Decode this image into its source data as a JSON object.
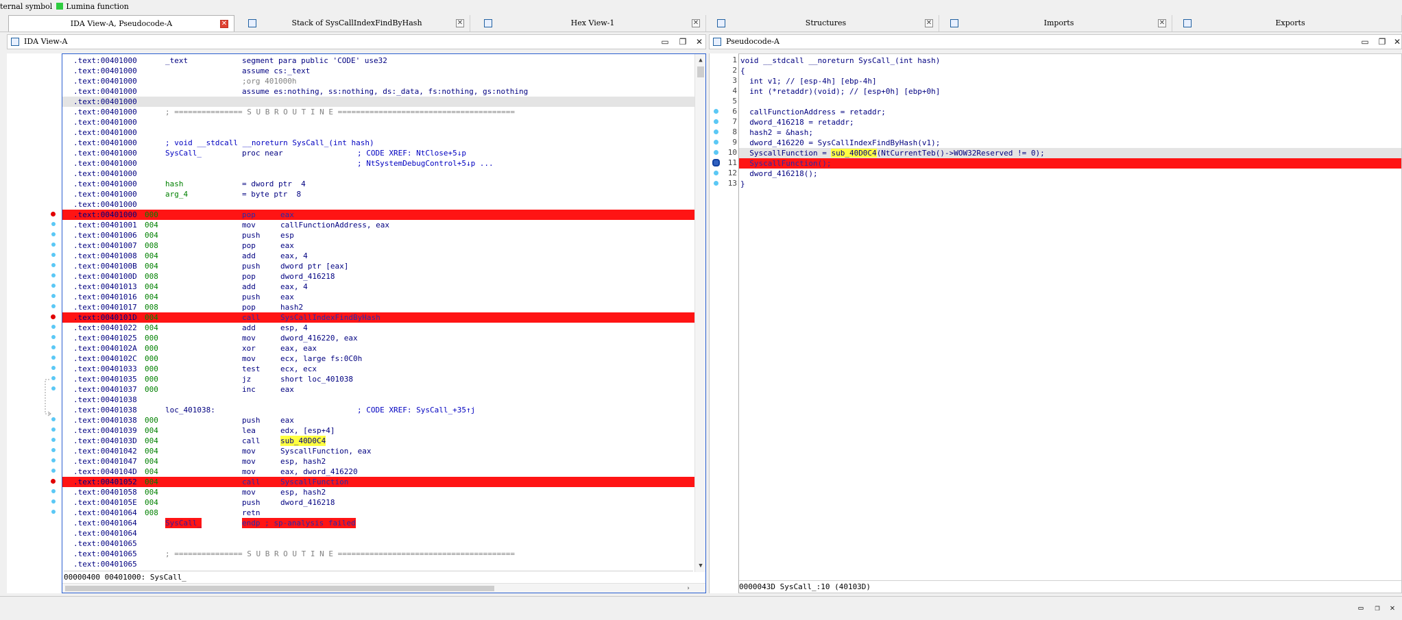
{
  "legend": {
    "prefix": "ternal symbol",
    "lumina": "Lumina function"
  },
  "tabs": [
    {
      "label": "IDA View-A, Pseudocode-A",
      "active": true
    },
    {
      "label": "Stack of SysCallIndexFindByHash"
    },
    {
      "label": "Hex View-1"
    },
    {
      "label": "Structures"
    },
    {
      "label": "Imports"
    },
    {
      "label": "Exports"
    }
  ],
  "ida_view": {
    "title": "IDA View-A",
    "status": "00000400 00401000: SysCall_",
    "lines": [
      {
        "a": ".text:00401000",
        "sp": "",
        "l": "_text",
        "i": "segment para public 'CODE' use32",
        "o": "",
        "c": "",
        "t": "seg"
      },
      {
        "a": ".text:00401000",
        "sp": "",
        "l": "",
        "i": "assume cs:_text",
        "o": "",
        "c": "",
        "t": "seg"
      },
      {
        "a": ".text:00401000",
        "sp": "",
        "l": "",
        "i": ";org 401000h",
        "o": "",
        "c": "",
        "t": "gray"
      },
      {
        "a": ".text:00401000",
        "sp": "",
        "l": "",
        "i": "assume es:nothing, ss:nothing, ds:_data, fs:nothing, gs:nothing",
        "o": "",
        "c": "",
        "t": "seg"
      },
      {
        "a": ".text:00401000",
        "sp": "",
        "l": "",
        "i": "",
        "o": "",
        "c": "",
        "t": "sel"
      },
      {
        "a": ".text:00401000",
        "sp": "",
        "l": "; =============== S U B R O U T I N E =======================================",
        "i": "",
        "o": "",
        "c": "",
        "t": "gray"
      },
      {
        "a": ".text:00401000",
        "sp": "",
        "l": "",
        "i": "",
        "o": "",
        "c": "",
        "t": ""
      },
      {
        "a": ".text:00401000",
        "sp": "",
        "l": "",
        "i": "",
        "o": "",
        "c": "",
        "t": ""
      },
      {
        "a": ".text:00401000",
        "sp": "",
        "l": "; void __stdcall __noreturn SysCall_(int hash)",
        "i": "",
        "o": "",
        "c": "",
        "t": "com"
      },
      {
        "a": ".text:00401000",
        "sp": "",
        "l": "SysCall_",
        "i": "proc near",
        "o": "",
        "c": "; CODE XREF: NtClose+5↓p",
        "t": "proc"
      },
      {
        "a": ".text:00401000",
        "sp": "",
        "l": "",
        "i": "",
        "o": "",
        "c": "; NtSystemDebugControl+5↓p ...",
        "t": ""
      },
      {
        "a": ".text:00401000",
        "sp": "",
        "l": "",
        "i": "",
        "o": "",
        "c": "",
        "t": ""
      },
      {
        "a": ".text:00401000",
        "sp": "",
        "l": "hash",
        "i": "= dword ptr  4",
        "o": "",
        "c": "",
        "t": "var"
      },
      {
        "a": ".text:00401000",
        "sp": "",
        "l": "arg_4",
        "i": "= byte ptr  8",
        "o": "",
        "c": "",
        "t": "var"
      },
      {
        "a": ".text:00401000",
        "sp": "",
        "l": "",
        "i": "",
        "o": "",
        "c": "",
        "t": ""
      },
      {
        "a": ".text:00401000",
        "sp": "000",
        "l": "",
        "i": "pop",
        "o": "eax",
        "c": "",
        "t": "bp"
      },
      {
        "a": ".text:00401001",
        "sp": "004",
        "l": "",
        "i": "mov",
        "o": "callFunctionAddress, eax",
        "c": "",
        "t": ""
      },
      {
        "a": ".text:00401006",
        "sp": "004",
        "l": "",
        "i": "push",
        "o": "esp",
        "c": "",
        "t": ""
      },
      {
        "a": ".text:00401007",
        "sp": "008",
        "l": "",
        "i": "pop",
        "o": "eax",
        "c": "",
        "t": ""
      },
      {
        "a": ".text:00401008",
        "sp": "004",
        "l": "",
        "i": "add",
        "o": "eax, 4",
        "c": "",
        "t": ""
      },
      {
        "a": ".text:0040100B",
        "sp": "004",
        "l": "",
        "i": "push",
        "o": "dword ptr [eax]",
        "c": "",
        "t": ""
      },
      {
        "a": ".text:0040100D",
        "sp": "008",
        "l": "",
        "i": "pop",
        "o": "dword_416218",
        "c": "",
        "t": ""
      },
      {
        "a": ".text:00401013",
        "sp": "004",
        "l": "",
        "i": "add",
        "o": "eax, 4",
        "c": "",
        "t": ""
      },
      {
        "a": ".text:00401016",
        "sp": "004",
        "l": "",
        "i": "push",
        "o": "eax",
        "c": "",
        "t": ""
      },
      {
        "a": ".text:00401017",
        "sp": "008",
        "l": "",
        "i": "pop",
        "o": "hash2",
        "c": "",
        "t": ""
      },
      {
        "a": ".text:0040101D",
        "sp": "004",
        "l": "",
        "i": "call",
        "o": "SysCallIndexFindByHash",
        "c": "",
        "t": "bp"
      },
      {
        "a": ".text:00401022",
        "sp": "004",
        "l": "",
        "i": "add",
        "o": "esp, 4",
        "c": "",
        "t": ""
      },
      {
        "a": ".text:00401025",
        "sp": "000",
        "l": "",
        "i": "mov",
        "o": "dword_416220, eax",
        "c": "",
        "t": ""
      },
      {
        "a": ".text:0040102A",
        "sp": "000",
        "l": "",
        "i": "xor",
        "o": "eax, eax",
        "c": "",
        "t": ""
      },
      {
        "a": ".text:0040102C",
        "sp": "000",
        "l": "",
        "i": "mov",
        "o": "ecx, large fs:0C0h",
        "c": "",
        "t": ""
      },
      {
        "a": ".text:00401033",
        "sp": "000",
        "l": "",
        "i": "test",
        "o": "ecx, ecx",
        "c": "",
        "t": ""
      },
      {
        "a": ".text:00401035",
        "sp": "000",
        "l": "",
        "i": "jz",
        "o": "short loc_401038",
        "c": "",
        "t": ""
      },
      {
        "a": ".text:00401037",
        "sp": "000",
        "l": "",
        "i": "inc",
        "o": "eax",
        "c": "",
        "t": ""
      },
      {
        "a": ".text:00401038",
        "sp": "",
        "l": "",
        "i": "",
        "o": "",
        "c": "",
        "t": ""
      },
      {
        "a": ".text:00401038",
        "sp": "",
        "l": "loc_401038:",
        "i": "",
        "o": "",
        "c": "; CODE XREF: SysCall_+35↑j",
        "t": "lbl"
      },
      {
        "a": ".text:00401038",
        "sp": "000",
        "l": "",
        "i": "push",
        "o": "eax",
        "c": "",
        "t": ""
      },
      {
        "a": ".text:00401039",
        "sp": "004",
        "l": "",
        "i": "lea",
        "o": "edx, [esp+4]",
        "c": "",
        "t": "lea"
      },
      {
        "a": ".text:0040103D",
        "sp": "004",
        "l": "",
        "i": "call",
        "o": "sub_40D0C4",
        "c": "",
        "t": "hly"
      },
      {
        "a": ".text:00401042",
        "sp": "004",
        "l": "",
        "i": "mov",
        "o": "SyscallFunction, eax",
        "c": "",
        "t": ""
      },
      {
        "a": ".text:00401047",
        "sp": "004",
        "l": "",
        "i": "mov",
        "o": "esp, hash2",
        "c": "",
        "t": ""
      },
      {
        "a": ".text:0040104D",
        "sp": "004",
        "l": "",
        "i": "mov",
        "o": "eax, dword_416220",
        "c": "",
        "t": ""
      },
      {
        "a": ".text:00401052",
        "sp": "004",
        "l": "",
        "i": "call",
        "o": "SyscallFunction",
        "c": "",
        "t": "bp"
      },
      {
        "a": ".text:00401058",
        "sp": "004",
        "l": "",
        "i": "mov",
        "o": "esp, hash2",
        "c": "",
        "t": ""
      },
      {
        "a": ".text:0040105E",
        "sp": "004",
        "l": "",
        "i": "push",
        "o": "dword_416218",
        "c": "",
        "t": ""
      },
      {
        "a": ".text:00401064",
        "sp": "008",
        "l": "",
        "i": "retn",
        "o": "",
        "c": "",
        "t": ""
      },
      {
        "a": ".text:00401064",
        "sp": "",
        "l": "SysCall_",
        "i": "endp ; sp-analysis failed",
        "o": "",
        "c": "",
        "t": "endp"
      },
      {
        "a": ".text:00401064",
        "sp": "",
        "l": "",
        "i": "",
        "o": "",
        "c": "",
        "t": ""
      },
      {
        "a": ".text:00401065",
        "sp": "",
        "l": "",
        "i": "",
        "o": "",
        "c": "",
        "t": ""
      },
      {
        "a": ".text:00401065",
        "sp": "",
        "l": "; =============== S U B R O U T I N E =======================================",
        "i": "",
        "o": "",
        "c": "",
        "t": "gray"
      },
      {
        "a": ".text:00401065",
        "sp": "",
        "l": "",
        "i": "",
        "o": "",
        "c": "",
        "t": ""
      }
    ]
  },
  "pseudocode": {
    "title": "Pseudocode-A",
    "status": "0000043D SysCall_:10 (40103D)",
    "lines": [
      {
        "n": "1",
        "text": "void __stdcall __noreturn SysCall_(int hash)",
        "t": ""
      },
      {
        "n": "2",
        "text": "{",
        "t": ""
      },
      {
        "n": "3",
        "text": "  int v1; // [esp-4h] [ebp-4h]",
        "t": "decl"
      },
      {
        "n": "4",
        "text": "  int (*retaddr)(void); // [esp+0h] [ebp+0h]",
        "t": "decl"
      },
      {
        "n": "5",
        "text": "",
        "t": ""
      },
      {
        "n": "6",
        "text": "  callFunctionAddress = retaddr;",
        "t": ""
      },
      {
        "n": "7",
        "text": "  dword_416218 = retaddr;",
        "t": ""
      },
      {
        "n": "8",
        "text": "  hash2 = &hash;",
        "t": ""
      },
      {
        "n": "9",
        "text": "  dword_416220 = SysCallIndexFindByHash(v1);",
        "t": ""
      },
      {
        "n": "10",
        "text": "  SyscallFunction = sub_40D0C4(NtCurrentTeb()->WOW32Reserved != 0);",
        "t": "cur"
      },
      {
        "n": "11",
        "text": "  SyscallFunction();",
        "t": "bp"
      },
      {
        "n": "12",
        "text": "  dword_416218();",
        "t": ""
      },
      {
        "n": "13",
        "text": "}",
        "t": ""
      }
    ]
  }
}
